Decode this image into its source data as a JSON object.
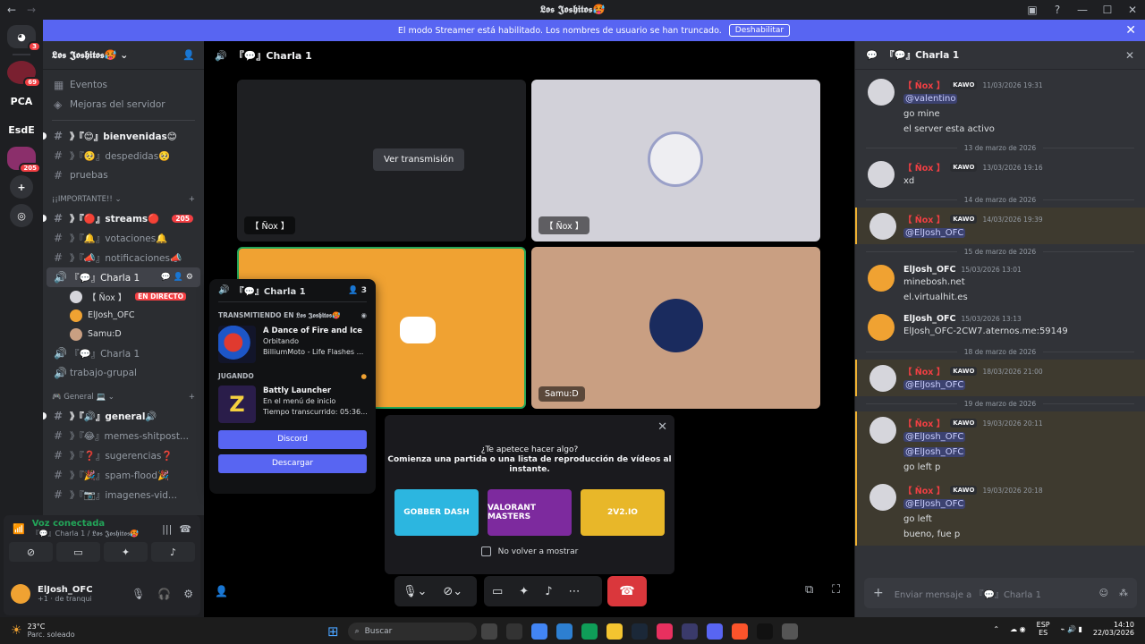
{
  "window": {
    "title": "𝕷𝖔𝖘 𝕵𝖔𝖘𝖍𝖎𝖙𝖔𝖘🥵"
  },
  "banner": {
    "text": "El modo Streamer está habilitado. Los nombres de usuario se han truncado.",
    "button": "Deshabilitar"
  },
  "servers": [
    {
      "label": "",
      "badge": "3"
    },
    {
      "label": "",
      "badge": "69"
    },
    {
      "label": "PCA",
      "badge": ""
    },
    {
      "label": "EsdE",
      "badge": ""
    },
    {
      "label": "",
      "badge": "205"
    }
  ],
  "sidebar": {
    "server_name": "𝕷𝖔𝖘 𝕵𝖔𝖘𝖍𝖎𝖙𝖔𝖘🥵",
    "top_items": [
      "Eventos",
      "Mejoras del servidor"
    ],
    "channels_a": [
      {
        "name": "》『😊』bienvenidas😊",
        "bold": true
      },
      {
        "name": "》『🥺』despedidas🥺",
        "bold": false
      },
      {
        "name": "pruebas",
        "bold": false
      }
    ],
    "category_important": "¡¡IMPORTANTE!!",
    "channels_b": [
      {
        "name": "》『🔴』streams🔴",
        "badge": "205",
        "bold": true
      },
      {
        "name": "》『🔔』votaciones🔔",
        "badge": "",
        "bold": false
      },
      {
        "name": "》『📣』notificaciones📣",
        "badge": "",
        "bold": false
      }
    ],
    "voice_channel": "『💬』Charla 1",
    "voice_users": [
      {
        "name": "【 Ñox 】",
        "live": "EN DIRECTO"
      },
      {
        "name": "ElJosh_OFC",
        "live": ""
      },
      {
        "name": "Samu:D",
        "live": ""
      }
    ],
    "voice_channel2": "『💬』Charla 1",
    "voice_channel3": "trabajo-grupal",
    "category_general": "🎮 General 💻",
    "channels_c": [
      {
        "name": "》『🔊』general🔊",
        "bold": true
      },
      {
        "name": "》『😂』memes-shitpost...",
        "bold": false
      },
      {
        "name": "》『❓』sugerencias❓",
        "bold": false
      },
      {
        "name": "》『🎉』spam-flood🎉",
        "bold": false
      },
      {
        "name": "》『📷』imagenes-vid...",
        "bold": false
      }
    ]
  },
  "voice_panel": {
    "status": "Voz conectada",
    "sub": "『💬』Charla 1 / 𝕷𝖔𝖘 𝕵𝖔𝖘𝖍𝖎𝖙𝖔𝖘🥵"
  },
  "user_panel": {
    "name": "ElJosh_OFC",
    "sub": "+1 · de tranqui"
  },
  "stage": {
    "title": "『💬』Charla 1",
    "tiles": [
      {
        "label": "【 Ñox 】",
        "button": "Ver transmisión"
      },
      {
        "label": "【 Ñox 】"
      },
      {
        "label": ""
      },
      {
        "label": "Samu:D"
      }
    ]
  },
  "popup": {
    "title": "『💬』Charla 1",
    "count": "3",
    "section1": "TRANSMITIENDO EN 𝕷𝖔𝖘 𝕵𝖔𝖘𝖍𝖎𝖙𝖔𝖘🥵",
    "stream": {
      "title": "A Dance of Fire and Ice",
      "line1": "Orbitando",
      "line2": "BilliumMoto - Life Flashes ..."
    },
    "section2": "JUGANDO",
    "game": {
      "title": "Battly Launcher",
      "line1": "En el menú de inicio",
      "line2": "Tiempo transcurrido: 05:36..."
    },
    "btn1": "Discord",
    "btn2": "Descargar"
  },
  "suggest": {
    "line1": "¿Te apetece hacer algo?",
    "line2": "Comienza una partida o una lista de reproducción de vídeos al",
    "line3": "instante.",
    "games": [
      "GOBBER DASH",
      "VALORANT MASTERS",
      "2V2.IO"
    ],
    "checkbox": "No volver a mostrar"
  },
  "chat": {
    "title": "『💬』Charla 1",
    "input_placeholder": "Enviar mensaje a 『💬』Charla 1",
    "messages": [
      {
        "type": "msg",
        "author": "【 Ñox 】",
        "tag": "KAWO",
        "time": "11/03/2026 19:31",
        "lines": [
          {
            "t": "@valentino",
            "m": true
          },
          {
            "t": "go mine",
            "m": false
          },
          {
            "t": "el server esta activo",
            "m": false
          }
        ],
        "hl": false,
        "red": true
      },
      {
        "type": "div",
        "text": "13 de marzo de 2026"
      },
      {
        "type": "msg",
        "author": "【 Ñox 】",
        "tag": "KAWO",
        "time": "13/03/2026 19:16",
        "lines": [
          {
            "t": "xd",
            "m": false
          }
        ],
        "hl": false,
        "red": true
      },
      {
        "type": "div",
        "text": "14 de marzo de 2026"
      },
      {
        "type": "msg",
        "author": "【 Ñox 】",
        "tag": "KAWO",
        "time": "14/03/2026 19:39",
        "lines": [
          {
            "t": "@ElJosh_OFC",
            "m": true
          }
        ],
        "hl": true,
        "red": true
      },
      {
        "type": "div",
        "text": "15 de marzo de 2026"
      },
      {
        "type": "msg",
        "author": "ElJosh_OFC",
        "tag": "",
        "time": "15/03/2026 13:01",
        "lines": [
          {
            "t": "minebosh.net",
            "m": false
          },
          {
            "t": "el.virtualhit.es",
            "m": false
          }
        ],
        "hl": false,
        "red": false
      },
      {
        "type": "msg",
        "author": "ElJosh_OFC",
        "tag": "",
        "time": "15/03/2026 13:13",
        "lines": [
          {
            "t": "ElJosh_OFC-2CW7.aternos.me:59149",
            "m": false
          }
        ],
        "hl": false,
        "red": false
      },
      {
        "type": "div",
        "text": "18 de marzo de 2026"
      },
      {
        "type": "msg",
        "author": "【 Ñox 】",
        "tag": "KAWO",
        "time": "18/03/2026 21:00",
        "lines": [
          {
            "t": "@ElJosh_OFC",
            "m": true
          }
        ],
        "hl": true,
        "red": true
      },
      {
        "type": "div",
        "text": "19 de marzo de 2026"
      },
      {
        "type": "msg",
        "author": "【 Ñox 】",
        "tag": "KAWO",
        "time": "19/03/2026 20:11",
        "lines": [
          {
            "t": "@ElJosh_OFC",
            "m": true
          },
          {
            "t": "@ElJosh_OFC",
            "m": true
          },
          {
            "t": "go left p",
            "m": false
          }
        ],
        "hl": true,
        "red": true
      },
      {
        "type": "msg",
        "author": "【 Ñox 】",
        "tag": "KAWO",
        "time": "19/03/2026 20:18",
        "lines": [
          {
            "t": "@ElJosh_OFC",
            "m": true
          },
          {
            "t": "go left",
            "m": false
          },
          {
            "t": "bueno, fue p",
            "m": false
          }
        ],
        "hl": true,
        "red": true
      }
    ]
  },
  "taskbar": {
    "weather_temp": "23°C",
    "weather_desc": "Parc. soleado",
    "search": "Buscar",
    "lang1": "ESP",
    "lang2": "ES",
    "time": "14:10",
    "date": "22/03/2026"
  },
  "colors": {
    "accent": "#5865f2",
    "danger": "#f23f43",
    "online": "#23a559"
  }
}
